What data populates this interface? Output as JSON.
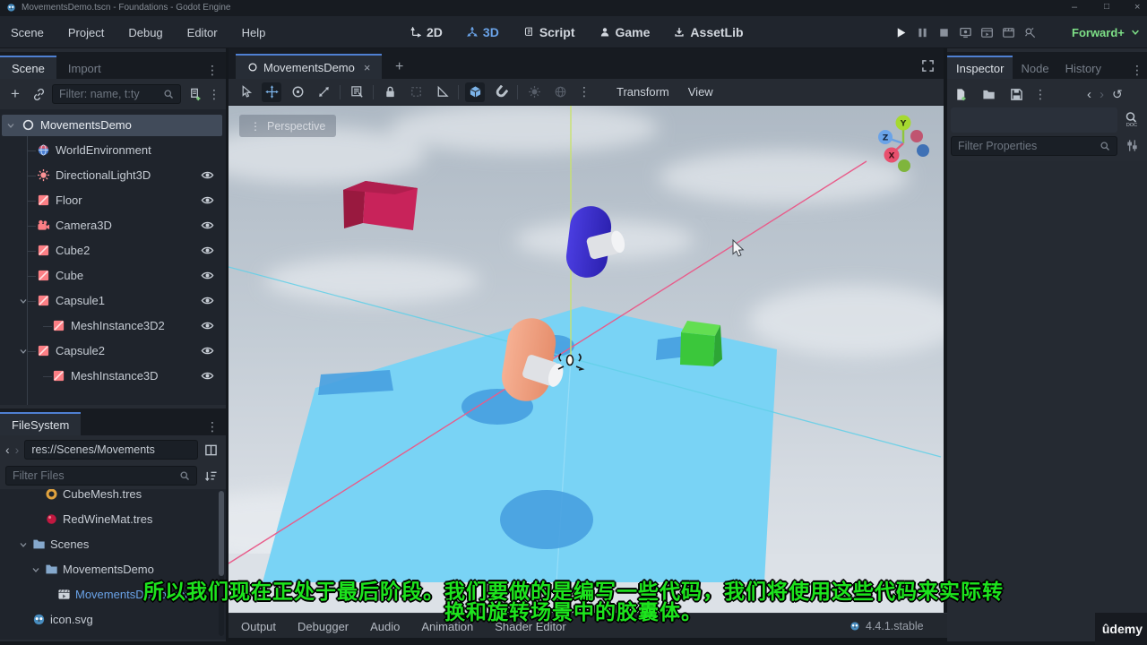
{
  "window": {
    "title": "MovementsDemo.tscn - Foundations - Godot Engine",
    "minimize": "–",
    "maximize": "□",
    "close": "×"
  },
  "menubar": {
    "items": [
      "Scene",
      "Project",
      "Debug",
      "Editor",
      "Help"
    ],
    "workspaces": [
      {
        "label": "2D",
        "icon": "ws-2d",
        "active": false
      },
      {
        "label": "3D",
        "icon": "ws-3d",
        "active": true
      },
      {
        "label": "Script",
        "icon": "ws-script",
        "active": false
      },
      {
        "label": "Game",
        "icon": "ws-game",
        "active": false
      },
      {
        "label": "AssetLib",
        "icon": "ws-assetlib",
        "active": false
      }
    ],
    "playback": [
      {
        "name": "play-button",
        "icon": "play",
        "bright": true
      },
      {
        "name": "pause-button",
        "icon": "pause",
        "bright": false
      },
      {
        "name": "stop-button",
        "icon": "stop",
        "bright": false
      },
      {
        "name": "remote-debug-button",
        "icon": "remote",
        "bright": false
      },
      {
        "name": "movie-run-button",
        "icon": "movie1",
        "bright": false
      },
      {
        "name": "movie-record-button",
        "icon": "movie2",
        "bright": false
      },
      {
        "name": "movie-maker-button",
        "icon": "magic",
        "bright": false
      }
    ],
    "renderer": "Forward+"
  },
  "scene_dock": {
    "tabs": [
      "Scene",
      "Import"
    ],
    "filter_placeholder": "Filter: name, t:ty",
    "tree": [
      {
        "name": "MovementsDemo",
        "type": "node3d",
        "depth": 0,
        "expanded": true,
        "selected": true,
        "eye": false
      },
      {
        "name": "WorldEnvironment",
        "type": "world",
        "depth": 1,
        "eye": false
      },
      {
        "name": "DirectionalLight3D",
        "type": "light",
        "depth": 1,
        "eye": true
      },
      {
        "name": "Floor",
        "type": "mesh",
        "depth": 1,
        "eye": true
      },
      {
        "name": "Camera3D",
        "type": "camera",
        "depth": 1,
        "eye": true
      },
      {
        "name": "Cube2",
        "type": "mesh",
        "depth": 1,
        "eye": true
      },
      {
        "name": "Cube",
        "type": "mesh",
        "depth": 1,
        "eye": true
      },
      {
        "name": "Capsule1",
        "type": "mesh",
        "depth": 1,
        "expanded": true,
        "eye": true
      },
      {
        "name": "MeshInstance3D2",
        "type": "mesh",
        "depth": 2,
        "eye": true
      },
      {
        "name": "Capsule2",
        "type": "mesh",
        "depth": 1,
        "expanded": true,
        "eye": true
      },
      {
        "name": "MeshInstance3D",
        "type": "mesh",
        "depth": 2,
        "eye": true
      }
    ]
  },
  "filesystem_dock": {
    "tab": "FileSystem",
    "path": "res://Scenes/Movements",
    "filter_placeholder": "Filter Files",
    "items": [
      {
        "name": "CubeMesh.tres",
        "type": "torus",
        "depth": 1
      },
      {
        "name": "RedWineMat.tres",
        "type": "matball",
        "depth": 1
      },
      {
        "name": "Scenes",
        "type": "folder",
        "depth": 0,
        "expanded": true
      },
      {
        "name": "MovementsDemo",
        "type": "folder",
        "depth": 1,
        "expanded": true
      },
      {
        "name": "MovementsDemo.tscn",
        "type": "clapper",
        "depth": 2,
        "selected": true
      },
      {
        "name": "icon.svg",
        "type": "godot",
        "depth": 0
      }
    ]
  },
  "viewport": {
    "scene_tab": "MovementsDemo",
    "perspective_button": "Perspective",
    "menus": [
      "Transform",
      "View"
    ],
    "tools": [
      {
        "name": "select-tool",
        "icon": "cursor-tool",
        "active": false
      },
      {
        "name": "move-tool",
        "icon": "move-tool",
        "active": true
      },
      {
        "name": "rotate-tool",
        "icon": "rotate-tool",
        "active": false
      },
      {
        "name": "scale-tool",
        "icon": "scale-tool",
        "active": false
      },
      {
        "name": "list-select-tool",
        "icon": "list-tool",
        "active": false
      },
      {
        "name": "lock-tool",
        "icon": "lock-tool",
        "active": false
      },
      {
        "name": "group-tool",
        "icon": "group-tool",
        "active": false,
        "dim": true
      },
      {
        "name": "ruler-tool",
        "icon": "ruler-tool",
        "active": false
      },
      {
        "name": "local-space-toggle",
        "icon": "local-tool",
        "active": true
      },
      {
        "name": "snap-toggle",
        "icon": "magnet-tool",
        "active": false
      },
      {
        "name": "sun-preview-toggle",
        "icon": "sun-tool",
        "active": false,
        "dim": true
      },
      {
        "name": "environment-preview-toggle",
        "icon": "env-tool",
        "active": false,
        "dim": true
      }
    ],
    "gizmo": {
      "x": "X",
      "y": "Y",
      "z": "Z"
    },
    "objects": {
      "floor": "#79d3f5",
      "crimson_cube": "#c8235a",
      "crimson_cube_side": "#99193f",
      "blue_capsule": "#3c2fd4",
      "orange_capsule": "#f0a184",
      "green_cube": "#3bc73b",
      "x_axis": "#e85c8a",
      "y_axis": "#c8e26e",
      "z_axis": "#62d0e8",
      "shadow": "#47a0e0"
    }
  },
  "inspector": {
    "tabs": [
      "Inspector",
      "Node",
      "History"
    ],
    "filter_placeholder": "Filter Properties"
  },
  "bottom_bar": {
    "tabs": [
      "Output",
      "Debugger",
      "Audio",
      "Animation",
      "Shader Editor"
    ],
    "version": "4.4.1.stable"
  },
  "subtitle": {
    "line1": "所以我们现在正处于最后阶段。我们要做的是编写一些代码，我们将使用这些代码来实际转",
    "line2": "换和旋转场景中的胶囊体。"
  },
  "watermark": "ûdemy",
  "colors": {
    "accent": "#699ce8",
    "selection_row": "#414b5a",
    "node_pink": "#fc7f85",
    "forward_green": "#7ee087",
    "subtitle_green": "#1de41d",
    "panel": "#262b33"
  }
}
